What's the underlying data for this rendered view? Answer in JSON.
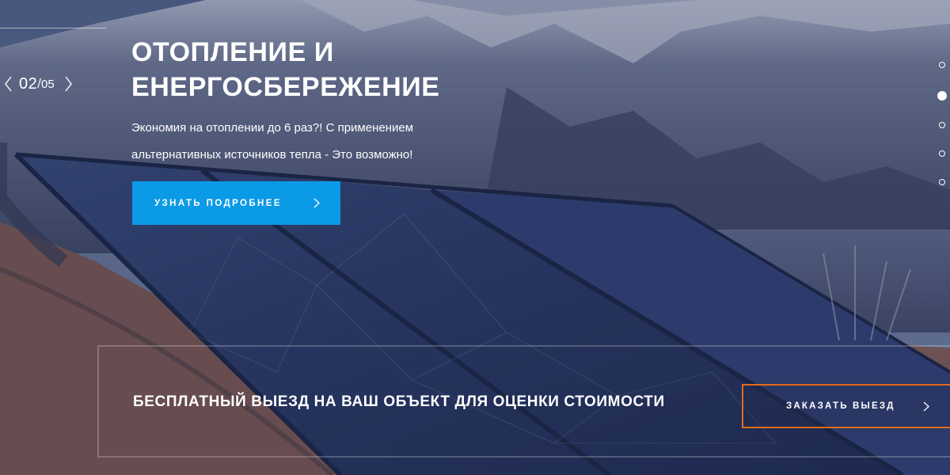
{
  "slider": {
    "current": "02",
    "slash": "/",
    "total": "05",
    "dots": [
      {
        "name": "slide-dot-1",
        "active": false
      },
      {
        "name": "slide-dot-2",
        "active": true
      },
      {
        "name": "slide-dot-3",
        "active": false
      },
      {
        "name": "slide-dot-4",
        "active": false
      },
      {
        "name": "slide-dot-5",
        "active": false
      }
    ]
  },
  "hero": {
    "title": "ОТОПЛЕНИЕ И ЕНЕРГОСБЕРЕЖЕНИЕ",
    "description": "Экономия на отоплении до 6 раз?! С применением альтернативных источников тепла - Это возможно!",
    "button_label": "УЗНАТЬ ПОДРОБНЕЕ"
  },
  "banner": {
    "text": "БЕСПЛАТНЫЙ ВЫЕЗД НА ВАШ ОБЪЕКТ ДЛЯ ОЦЕНКИ СТОИМОСТИ",
    "button_label": "ЗАКАЗАТЬ ВЫЕЗД"
  },
  "colors": {
    "primary_button": "#0b9ae6",
    "order_button_border": "#e56a1c"
  },
  "icons": [
    "chevron-left-icon",
    "chevron-right-icon"
  ]
}
